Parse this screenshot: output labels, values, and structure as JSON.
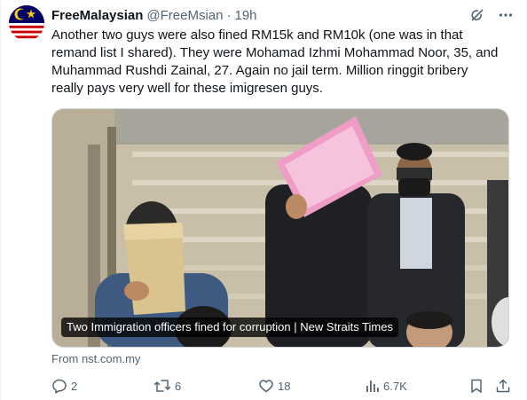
{
  "tweet": {
    "author_name": "FreeMalaysian",
    "author_handle": "@FreeMsian",
    "separator": "·",
    "time": "19h",
    "text": "Another two guys were also fined RM15k and RM10k (one was in that\nremand list I shared). They were Mohamad Izhmi Mohammad Noor, 35, and\nMuhammad Rushdi Zainal, 27. Again no jail term. Million ringgit bribery\nreally pays very well for these imigresen guys.",
    "header_icons": [
      "grok-icon",
      "more-icon"
    ]
  },
  "media": {
    "caption": "Two Immigration officers fined for corruption | New Straits Times"
  },
  "source": {
    "label": "From nst.com.my"
  },
  "actions": {
    "reply_count": "2",
    "retweet_count": "6",
    "like_count": "18",
    "view_count": "6.7K"
  },
  "colors": {
    "text": "#0f1419",
    "secondary": "#536471",
    "border": "#cfd9de",
    "flag_blue": "#010066",
    "flag_red": "#cc0001",
    "flag_yellow": "#ffcc00"
  }
}
